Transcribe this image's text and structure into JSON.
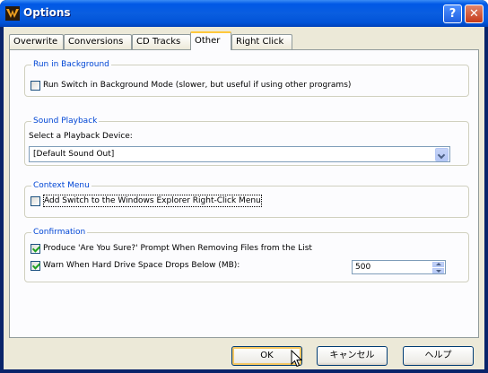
{
  "window": {
    "title": "Options"
  },
  "tabs": [
    {
      "label": "Overwrite",
      "active": false
    },
    {
      "label": "Conversions",
      "active": false
    },
    {
      "label": "CD Tracks",
      "active": false
    },
    {
      "label": "Other",
      "active": true
    },
    {
      "label": "Right Click",
      "active": false
    }
  ],
  "groups": {
    "background": {
      "label": "Run in Background",
      "checkbox_label": "Run Switch in Background Mode (slower, but useful if using other programs)",
      "checked": false
    },
    "sound": {
      "label": "Sound Playback",
      "select_label": "Select a Playback Device:",
      "selected_device": "[Default Sound Out]"
    },
    "context_menu": {
      "label": "Context Menu",
      "checkbox_label": "Add Switch to the Windows Explorer Right-Click Menu",
      "checked": false
    },
    "confirmation": {
      "label": "Confirmation",
      "confirm_remove_label": "Produce 'Are You Sure?' Prompt When Removing Files from the List",
      "confirm_remove_checked": true,
      "disk_warning_label": "Warn When Hard Drive Space Drops Below (MB):",
      "disk_warning_checked": true,
      "disk_warning_value": "500"
    }
  },
  "buttons": {
    "ok": "OK",
    "cancel": "キャンセル",
    "help": "ヘルプ"
  },
  "colors": {
    "titlebar": "#0058e6",
    "group_label": "#0046d5",
    "active_tab_accent": "#ffc83c",
    "check": "#21a121"
  }
}
